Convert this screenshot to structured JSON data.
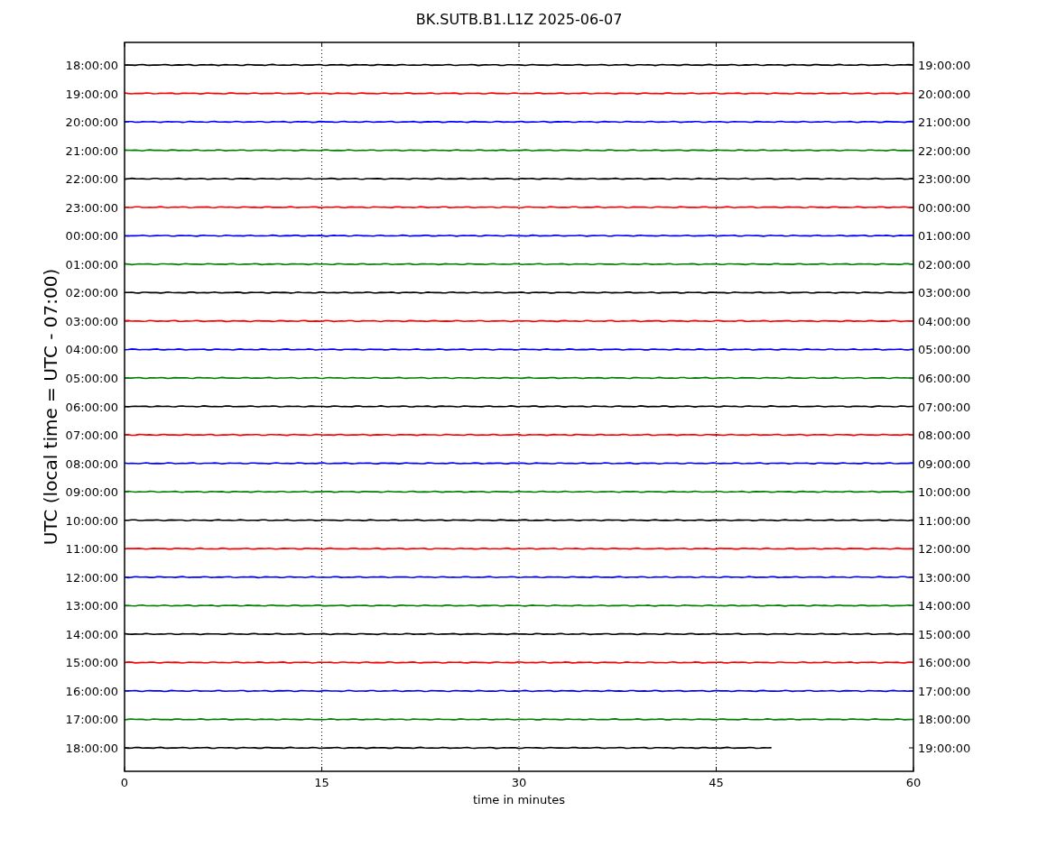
{
  "title": "BK.SUTB.B1.L1Z 2025-06-07",
  "ylabel": "UTC (local time = UTC - 07:00)",
  "xlabel": "time in minutes",
  "xticks": [
    "0",
    "15",
    "30",
    "45",
    "60"
  ],
  "traces": [
    {
      "left": "18:00:00",
      "right": "19:00:00",
      "color": "#000000",
      "level": 1
    },
    {
      "left": "19:00:00",
      "right": "20:00:00",
      "color": "#ff0000",
      "level": 1
    },
    {
      "left": "20:00:00",
      "right": "21:00:00",
      "color": "#0000ff",
      "level": 1
    },
    {
      "left": "21:00:00",
      "right": "22:00:00",
      "color": "#008000",
      "level": 1
    },
    {
      "left": "22:00:00",
      "right": "23:00:00",
      "color": "#000000",
      "level": 1
    },
    {
      "left": "23:00:00",
      "right": "00:00:00",
      "color": "#ff0000",
      "level": 1
    },
    {
      "left": "00:00:00",
      "right": "01:00:00",
      "color": "#0000ff",
      "level": 1
    },
    {
      "left": "01:00:00",
      "right": "02:00:00",
      "color": "#008000",
      "level": 1
    },
    {
      "left": "02:00:00",
      "right": "03:00:00",
      "color": "#000000",
      "level": 1
    },
    {
      "left": "03:00:00",
      "right": "04:00:00",
      "color": "#ff0000",
      "level": 1
    },
    {
      "left": "04:00:00",
      "right": "05:00:00",
      "color": "#0000ff",
      "level": 1
    },
    {
      "left": "05:00:00",
      "right": "06:00:00",
      "color": "#008000",
      "level": 1
    },
    {
      "left": "06:00:00",
      "right": "07:00:00",
      "color": "#000000",
      "level": 1
    },
    {
      "left": "07:00:00",
      "right": "08:00:00",
      "color": "#ff0000",
      "level": 1
    },
    {
      "left": "08:00:00",
      "right": "09:00:00",
      "color": "#0000ff",
      "level": 1
    },
    {
      "left": "09:00:00",
      "right": "10:00:00",
      "color": "#008000",
      "level": 1
    },
    {
      "left": "10:00:00",
      "right": "11:00:00",
      "color": "#000000",
      "level": 1
    },
    {
      "left": "11:00:00",
      "right": "12:00:00",
      "color": "#ff0000",
      "level": 1
    },
    {
      "left": "12:00:00",
      "right": "13:00:00",
      "color": "#0000ff",
      "level": 1
    },
    {
      "left": "13:00:00",
      "right": "14:00:00",
      "color": "#008000",
      "level": 1
    },
    {
      "left": "14:00:00",
      "right": "15:00:00",
      "color": "#000000",
      "level": 1
    },
    {
      "left": "15:00:00",
      "right": "16:00:00",
      "color": "#ff0000",
      "level": 1
    },
    {
      "left": "16:00:00",
      "right": "17:00:00",
      "color": "#0000ff",
      "level": 1
    },
    {
      "left": "17:00:00",
      "right": "18:00:00",
      "color": "#008000",
      "level": 1
    },
    {
      "left": "18:00:00",
      "right": "19:00:00",
      "color": "#000000",
      "level": 0.82
    }
  ]
}
